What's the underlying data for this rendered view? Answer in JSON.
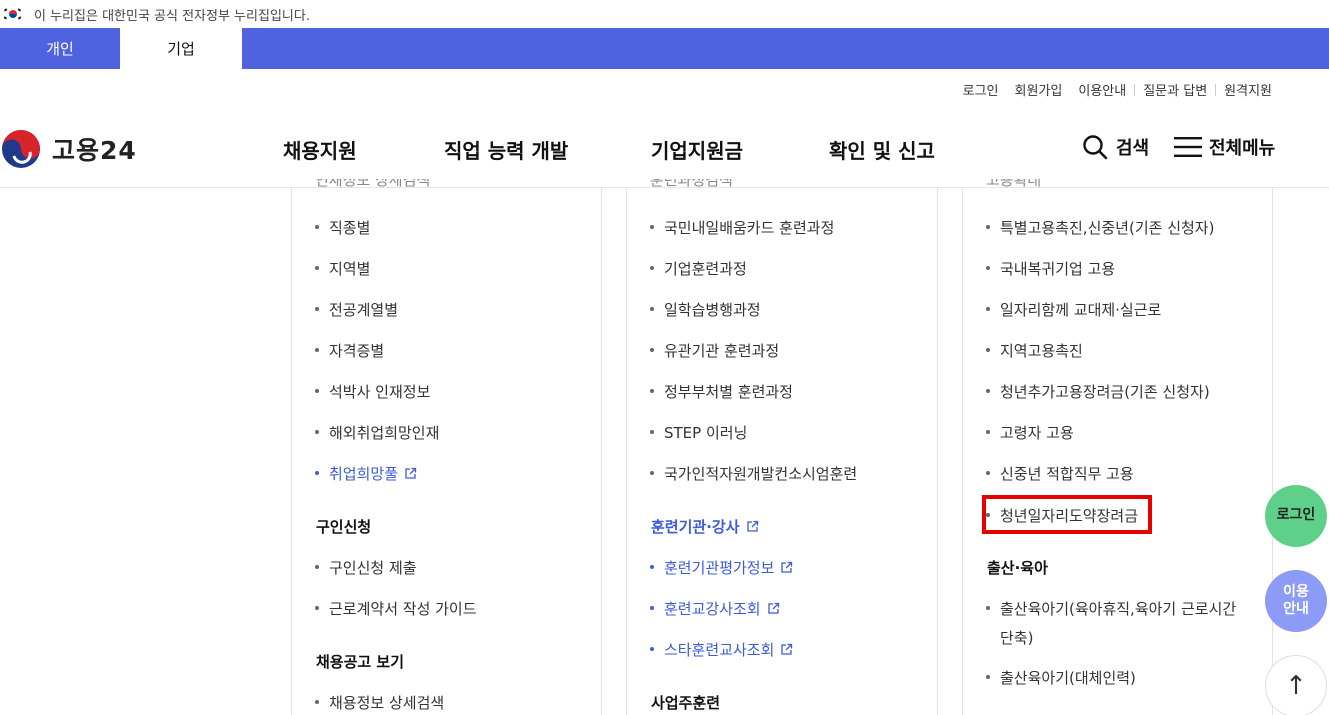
{
  "gov_banner": {
    "text": "이 누리집은 대한민국 공식 전자정부 누리집입니다."
  },
  "tabs": [
    {
      "label": "개인",
      "active": false
    },
    {
      "label": "기업",
      "active": true
    }
  ],
  "utility_links": [
    "로그인",
    "회원가입",
    "이용안내",
    "질문과 답변",
    "원격지원"
  ],
  "logo": {
    "text": "고용24"
  },
  "gnb": [
    "채용지원",
    "직업 능력 개발",
    "기업지원금",
    "확인 및 신고"
  ],
  "header_tools": {
    "search": "검색",
    "menu": "전체메뉴"
  },
  "columns": {
    "col1": {
      "cut_title": "인재정보 상세검색",
      "items": [
        "직종별",
        "지역별",
        "전공계열별",
        "자격증별",
        "석박사 인재정보",
        "해외취업희망인재"
      ],
      "link_item": "취업희망풀",
      "section_apply": "구인신청",
      "apply_items": [
        "구인신청 제출",
        "근로계약서 작성 가이드"
      ],
      "section_view": "채용공고 보기",
      "view_items": [
        "채용정보 상세검색"
      ]
    },
    "col2": {
      "cut_title": "훈련과정검색",
      "items": [
        "국민내일배움카드 훈련과정",
        "기업훈련과정",
        "일학습병행과정",
        "유관기관 훈련과정",
        "정부부처별 훈련과정",
        "STEP 이러닝",
        "국가인적자원개발컨소시엄훈련"
      ],
      "section_institution": "훈련기관·강사",
      "institution_items": [
        "훈련기관평가정보",
        "훈련교강사조회",
        "스타훈련교사조회"
      ],
      "section_employer": "사업주훈련"
    },
    "col3": {
      "cut_title": "고용확대",
      "items": [
        "특별고용촉진,신중년(기존 신청자)",
        "국내복귀기업 고용",
        "일자리함께 교대제·실근로",
        "지역고용촉진",
        "청년추가고용장려금(기존 신청자)",
        "고령자 고용",
        "신중년 적합직무 고용"
      ],
      "highlighted_item": "청년일자리도약장려금",
      "section_childbirth": "출산·육아",
      "childbirth_items": [
        "출산육아기(육아휴직,육아기 근로시간",
        "단축)",
        "출산육아기(대체인력)"
      ]
    }
  },
  "floating": {
    "login": "로그인",
    "guide_line1": "이용",
    "guide_line2": "안내",
    "top": "↑"
  },
  "colors": {
    "tab_bar": "#4f63e0",
    "link": "#3e5bd8",
    "highlight": "#e60000",
    "login_fab": "#5fd08a",
    "guide_fab": "#8c9bf5"
  }
}
